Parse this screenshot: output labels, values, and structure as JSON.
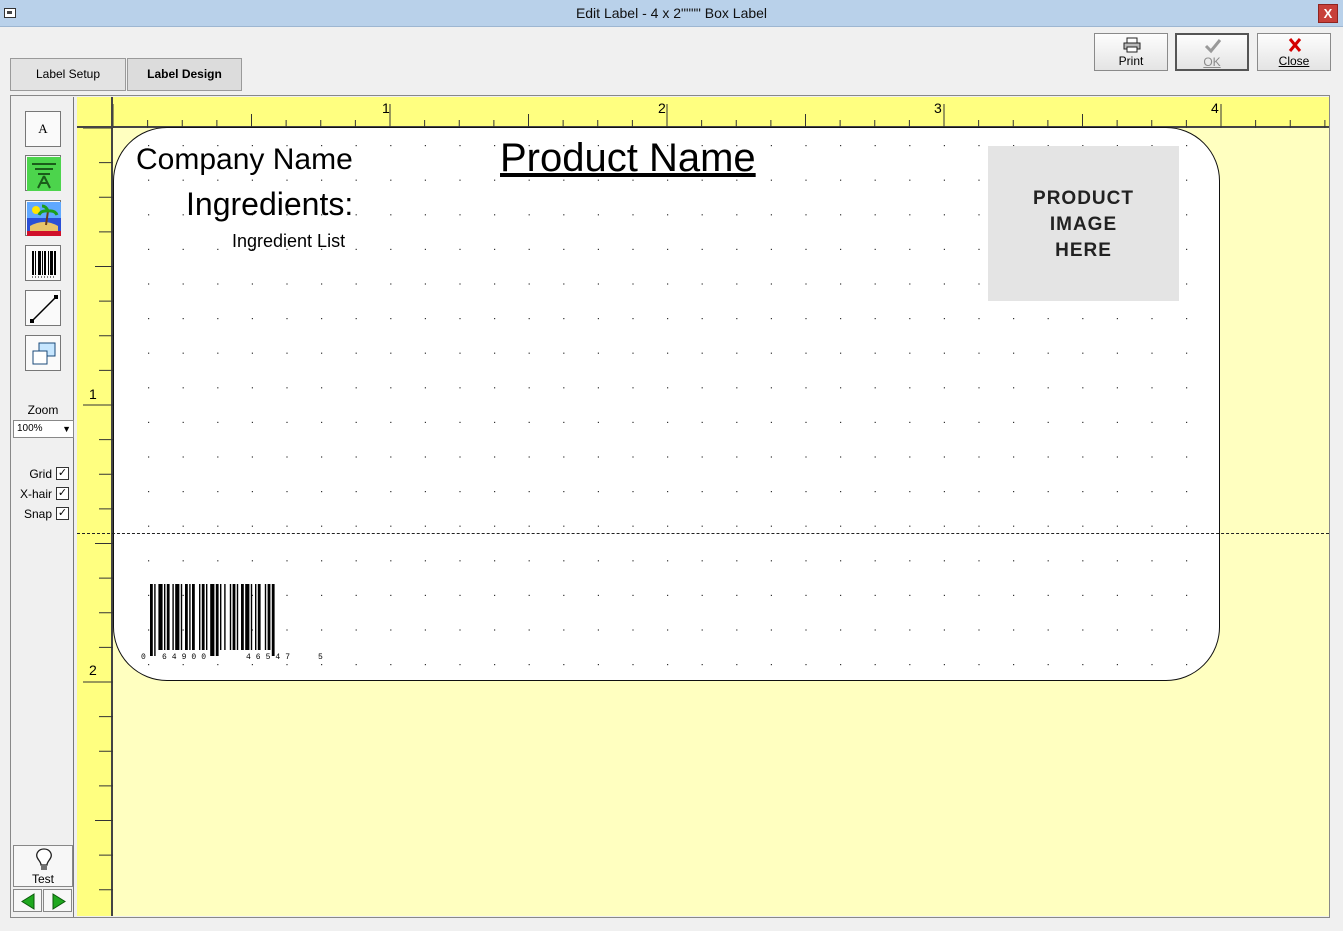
{
  "window": {
    "title": "Edit Label - 4 x 2\"\"\"\" Box Label",
    "close_glyph": "X"
  },
  "tabs": [
    {
      "label": "Label Setup"
    },
    {
      "label": "Label Design"
    }
  ],
  "buttons": {
    "print": {
      "label": "Print",
      "icon": "printer-icon"
    },
    "ok": {
      "label": "OK",
      "icon": "checkmark-icon",
      "enabled": false
    },
    "close": {
      "label": "Close",
      "icon": "red-x-icon",
      "color": "#d40000"
    }
  },
  "toolbar": {
    "tools": [
      {
        "name": "text-tool",
        "icon": "letter-a-icon"
      },
      {
        "name": "logo-tool",
        "icon": "green-banner-icon"
      },
      {
        "name": "image-tool",
        "icon": "island-picture-icon"
      },
      {
        "name": "barcode-tool",
        "icon": "barcode-icon"
      },
      {
        "name": "line-tool",
        "icon": "diagonal-line-icon"
      },
      {
        "name": "box-tool",
        "icon": "overlapping-boxes-icon"
      }
    ],
    "zoom_label": "Zoom",
    "zoom_value": "100%",
    "checkboxes": [
      {
        "label": "Grid",
        "checked": true
      },
      {
        "label": "X-hair",
        "checked": true
      },
      {
        "label": "Snap",
        "checked": true
      }
    ],
    "test_label": "Test"
  },
  "rulers": {
    "top_labels": [
      "1",
      "2",
      "3",
      "4"
    ],
    "left_labels": [
      "1",
      "2"
    ]
  },
  "label": {
    "company_name": "Company Name",
    "ingredients_heading": "Ingredients:",
    "ingredient_list": "Ingredient List",
    "product_name": "Product Name",
    "product_image_lines": [
      "PRODUCT",
      "IMAGE",
      "HERE"
    ],
    "barcode_digits": [
      "0",
      "64900",
      "46547",
      "5"
    ]
  },
  "colors": {
    "canvas": "#ffffc0",
    "ruler": "#ffff80",
    "titlebar": "#b9d1ea",
    "image_placeholder": "#e4e4e4"
  }
}
